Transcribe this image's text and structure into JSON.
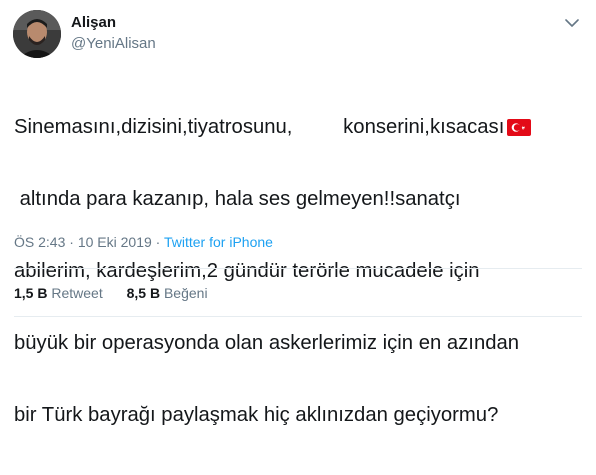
{
  "tweet": {
    "display_name": "Alişan",
    "handle": "@YeniAlisan",
    "lines": [
      "Sinemasını,dizisini,tiyatrosunu,         konserini,kısacası",
      " altında para kazanıp, hala ses gelmeyen!!sanatçı",
      "abilerim, kardeşlerim,2 gündür terörle mucadele için",
      "büyük bir operasyonda olan askerlerimiz için en azından",
      "bir Türk bayrağı paylaşmak hiç aklınızdan geçiyormu?"
    ],
    "flag_icon": "turkey-flag-icon",
    "time": "ÖS 2:43",
    "separator": " · ",
    "date": "10 Eki 2019",
    "source": "Twitter for iPhone",
    "stats": {
      "retweet_count": "1,5 B",
      "retweet_label": "Retweet",
      "like_count": "8,5 B",
      "like_label": "Beğeni"
    }
  },
  "colors": {
    "text": "#14171a",
    "secondary": "#657786",
    "link": "#1da1f2",
    "divider": "#e6ecf0",
    "flag_red": "#e30a17"
  }
}
